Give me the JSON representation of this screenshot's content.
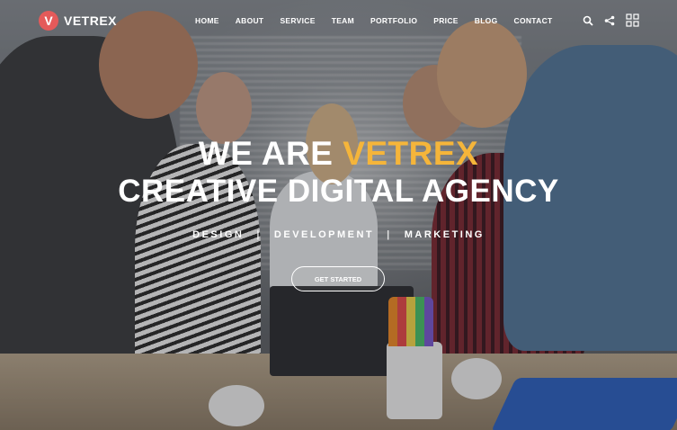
{
  "brand": {
    "mark": "V",
    "name": "VETREX",
    "accent_color": "#e45a5a"
  },
  "nav": {
    "items": [
      "HOME",
      "ABOUT",
      "SERVICE",
      "TEAM",
      "PORTFOLIO",
      "PRICE",
      "BLOG",
      "CONTACT"
    ]
  },
  "tools": {
    "search_icon": "search-icon",
    "share_icon": "share-icon",
    "grid_icon": "grid-menu-icon"
  },
  "hero": {
    "line1_prefix": "WE ARE ",
    "line1_accent": "VETREX",
    "line2": "CREATIVE DIGITAL AGENCY",
    "accent_color": "#f5b53a",
    "services": [
      "DESIGN",
      "DEVELOPMENT",
      "MARKETING"
    ],
    "separator": "|",
    "cta_label": "GET STARTED"
  }
}
